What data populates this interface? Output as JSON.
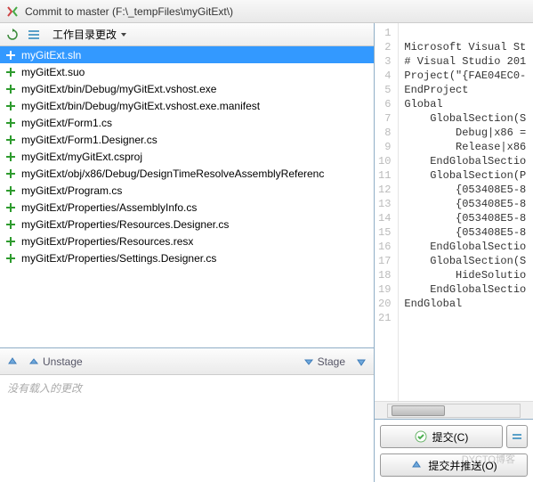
{
  "window": {
    "title": "Commit to master (F:\\_tempFiles\\myGitExt\\)"
  },
  "toolbar": {
    "dropdown_label": "工作目录更改"
  },
  "files": [
    {
      "name": "myGitExt.sln",
      "selected": true
    },
    {
      "name": "myGitExt.suo",
      "selected": false
    },
    {
      "name": "myGitExt/bin/Debug/myGitExt.vshost.exe",
      "selected": false
    },
    {
      "name": "myGitExt/bin/Debug/myGitExt.vshost.exe.manifest",
      "selected": false
    },
    {
      "name": "myGitExt/Form1.cs",
      "selected": false
    },
    {
      "name": "myGitExt/Form1.Designer.cs",
      "selected": false
    },
    {
      "name": "myGitExt/myGitExt.csproj",
      "selected": false
    },
    {
      "name": "myGitExt/obj/x86/Debug/DesignTimeResolveAssemblyReferenc",
      "selected": false
    },
    {
      "name": "myGitExt/Program.cs",
      "selected": false
    },
    {
      "name": "myGitExt/Properties/AssemblyInfo.cs",
      "selected": false
    },
    {
      "name": "myGitExt/Properties/Resources.Designer.cs",
      "selected": false
    },
    {
      "name": "myGitExt/Properties/Resources.resx",
      "selected": false
    },
    {
      "name": "myGitExt/Properties/Settings.Designer.cs",
      "selected": false
    }
  ],
  "stage_bar": {
    "unstage": "Unstage",
    "stage": "Stage"
  },
  "staged_placeholder": "没有载入的更改",
  "code": {
    "lines": [
      "",
      "Microsoft Visual St",
      "# Visual Studio 201",
      "Project(\"{FAE04EC0-",
      "EndProject",
      "Global",
      "    GlobalSection(S",
      "        Debug|x86 =",
      "        Release|x86",
      "    EndGlobalSectio",
      "    GlobalSection(P",
      "        {053408E5-8",
      "        {053408E5-8",
      "        {053408E5-8",
      "        {053408E5-8",
      "    EndGlobalSectio",
      "    GlobalSection(S",
      "        HideSolutio",
      "    EndGlobalSectio",
      "EndGlobal",
      ""
    ]
  },
  "buttons": {
    "commit": "提交(C)",
    "commit_push": "提交并推送(O)"
  },
  "watermark": "DYCTO博客"
}
